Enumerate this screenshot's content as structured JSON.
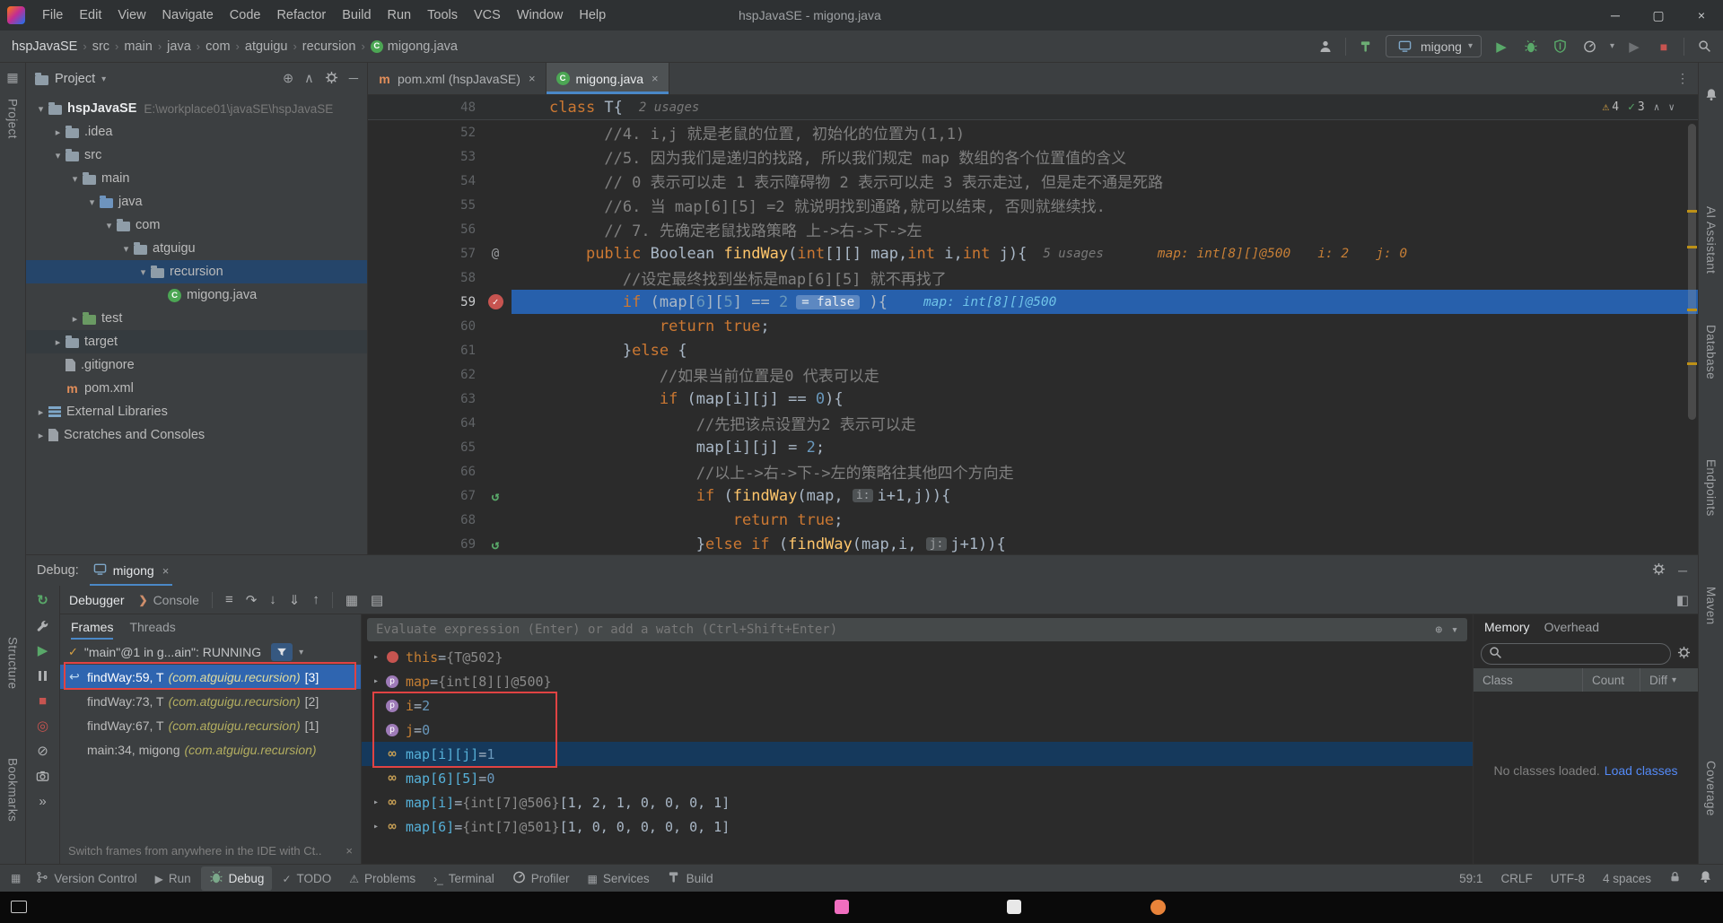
{
  "window": {
    "title": "hspJavaSE - migong.java"
  },
  "menubar": [
    "File",
    "Edit",
    "View",
    "Navigate",
    "Code",
    "Refactor",
    "Build",
    "Run",
    "Tools",
    "VCS",
    "Window",
    "Help"
  ],
  "breadcrumbs": [
    "hspJavaSE",
    "src",
    "main",
    "java",
    "com",
    "atguigu",
    "recursion",
    "migong.java"
  ],
  "run": {
    "config": "migong"
  },
  "left_strip": {
    "labels": [
      "Project",
      "Structure",
      "Bookmarks"
    ]
  },
  "right_strip": {
    "labels": [
      "AI Assistant",
      "Database",
      "Endpoints",
      "Maven",
      "Coverage"
    ]
  },
  "project": {
    "title": "Project",
    "tree": [
      {
        "label": "hspJavaSE",
        "suffix": "E:\\workplace01\\javaSE\\hspJavaSE",
        "level": 0,
        "icon": "folder",
        "chev": "open",
        "bold": true
      },
      {
        "label": ".idea",
        "level": 1,
        "icon": "folder",
        "chev": "closed"
      },
      {
        "label": "src",
        "level": 1,
        "icon": "folder",
        "chev": "open"
      },
      {
        "label": "main",
        "level": 2,
        "icon": "folder",
        "chev": "open"
      },
      {
        "label": "java",
        "level": 3,
        "icon": "folder-src",
        "chev": "open"
      },
      {
        "label": "com",
        "level": 4,
        "icon": "folder",
        "chev": "open"
      },
      {
        "label": "atguigu",
        "level": 5,
        "icon": "folder",
        "chev": "open"
      },
      {
        "label": "recursion",
        "level": 6,
        "icon": "folder",
        "chev": "open",
        "selected": true
      },
      {
        "label": "migong.java",
        "level": 7,
        "icon": "class"
      },
      {
        "label": "test",
        "level": 2,
        "icon": "folder-test",
        "chev": "closed"
      },
      {
        "label": "target",
        "level": 1,
        "icon": "folder",
        "chev": "closed",
        "hover": true
      },
      {
        "label": ".gitignore",
        "level": 1,
        "icon": "file"
      },
      {
        "label": "pom.xml",
        "level": 1,
        "icon": "maven"
      },
      {
        "label": "External Libraries",
        "level": 0,
        "icon": "lib",
        "chev": "closed"
      },
      {
        "label": "Scratches and Consoles",
        "level": 0,
        "icon": "scratch",
        "chev": "closed"
      }
    ]
  },
  "editor": {
    "tabs": [
      {
        "label": "pom.xml (hspJavaSE)",
        "icon": "maven"
      },
      {
        "label": "migong.java",
        "icon": "class",
        "active": true
      }
    ],
    "sticky": {
      "num": "48",
      "segments": [
        {
          "c": "k",
          "t": "class "
        },
        {
          "c": "p",
          "t": "T{"
        },
        {
          "c": "u",
          "t": "2 usages"
        }
      ]
    },
    "inspections": {
      "warnings": "4",
      "passed": "3"
    },
    "lines": [
      {
        "num": "52",
        "segments": [
          {
            "c": "cmt",
            "t": "      //4. i,j 就是老鼠的位置, 初始化的位置为(1,1)"
          }
        ]
      },
      {
        "num": "53",
        "segments": [
          {
            "c": "cmt",
            "t": "      //5. 因为我们是递归的找路, 所以我们规定 map 数组的各个位置值的含义"
          }
        ]
      },
      {
        "num": "54",
        "segments": [
          {
            "c": "cmt",
            "t": "      // 0 表示可以走 1 表示障碍物 2 表示可以走 3 表示走过, 但是走不通是死路"
          }
        ]
      },
      {
        "num": "55",
        "segments": [
          {
            "c": "cmt",
            "t": "      //6. 当 map[6][5] =2 就说明找到通路,就可以结束, 否则就继续找."
          }
        ]
      },
      {
        "num": "56",
        "segments": [
          {
            "c": "cmt",
            "t": "      // 7. 先确定老鼠找路策略 上->右->下->左"
          }
        ]
      },
      {
        "num": "57",
        "icon": "at",
        "segments": [
          {
            "c": "p",
            "t": "    "
          },
          {
            "c": "k",
            "t": "public "
          },
          {
            "c": "p",
            "t": "Boolean "
          },
          {
            "c": "m",
            "t": "findWay"
          },
          {
            "c": "p",
            "t": "("
          },
          {
            "c": "k",
            "t": "int"
          },
          {
            "c": "p",
            "t": "[][] map,"
          },
          {
            "c": "k",
            "t": "int"
          },
          {
            "c": "p",
            "t": " i,"
          },
          {
            "c": "k",
            "t": "int"
          },
          {
            "c": "p",
            "t": " j){"
          },
          {
            "c": "u",
            "t": "5 usages"
          },
          {
            "c": "hg gapxl",
            "t": "map: int[8][]@500"
          },
          {
            "c": "hg gap",
            "t": "i: 2"
          },
          {
            "c": "hg gap",
            "t": "j: 0"
          }
        ]
      },
      {
        "num": "58",
        "segments": [
          {
            "c": "cmt",
            "t": "        //设定最终找到坐标是map[6][5] 就不再找了"
          }
        ]
      },
      {
        "num": "59",
        "icon": "bp",
        "exec": true,
        "segments": [
          {
            "c": "p",
            "t": "        "
          },
          {
            "c": "k",
            "t": "if"
          },
          {
            "c": "p",
            "t": " (map["
          },
          {
            "c": "n",
            "t": "6"
          },
          {
            "c": "p",
            "t": "]["
          },
          {
            "c": "n",
            "t": "5"
          },
          {
            "c": "p",
            "t": "] == "
          },
          {
            "c": "n",
            "t": "2"
          },
          {
            "c": "chip",
            "t": "= false"
          },
          {
            "c": "p",
            "t": " ){"
          },
          {
            "c": "hc gapl",
            "t": "map: int[8][]@500"
          }
        ]
      },
      {
        "num": "60",
        "segments": [
          {
            "c": "p",
            "t": "            "
          },
          {
            "c": "k",
            "t": "return true"
          },
          {
            "c": "p",
            "t": ";"
          }
        ]
      },
      {
        "num": "61",
        "segments": [
          {
            "c": "p",
            "t": "        }"
          },
          {
            "c": "k",
            "t": "else"
          },
          {
            "c": "p",
            "t": " {"
          }
        ]
      },
      {
        "num": "62",
        "segments": [
          {
            "c": "cmt",
            "t": "            //如果当前位置是0 代表可以走"
          }
        ]
      },
      {
        "num": "63",
        "segments": [
          {
            "c": "p",
            "t": "            "
          },
          {
            "c": "k",
            "t": "if"
          },
          {
            "c": "p",
            "t": " (map[i][j] == "
          },
          {
            "c": "n",
            "t": "0"
          },
          {
            "c": "p",
            "t": "){"
          }
        ]
      },
      {
        "num": "64",
        "segments": [
          {
            "c": "cmt",
            "t": "                //先把该点设置为2 表示可以走"
          }
        ]
      },
      {
        "num": "65",
        "segments": [
          {
            "c": "p",
            "t": "                map[i][j] = "
          },
          {
            "c": "n",
            "t": "2"
          },
          {
            "c": "p",
            "t": ";"
          }
        ]
      },
      {
        "num": "66",
        "segments": [
          {
            "c": "cmt",
            "t": "                //以上->右->下->左的策略往其他四个方向走"
          }
        ]
      },
      {
        "num": "67",
        "icon": "recur",
        "segments": [
          {
            "c": "p",
            "t": "                "
          },
          {
            "c": "k",
            "t": "if"
          },
          {
            "c": "p",
            "t": " ("
          },
          {
            "c": "m",
            "t": "findWay"
          },
          {
            "c": "p",
            "t": "(map, "
          },
          {
            "c": "pchip",
            "t": "i:"
          },
          {
            "c": "p",
            "t": "i+1,j)){"
          }
        ]
      },
      {
        "num": "68",
        "segments": [
          {
            "c": "p",
            "t": "                    "
          },
          {
            "c": "k",
            "t": "return true"
          },
          {
            "c": "p",
            "t": ";"
          }
        ]
      },
      {
        "num": "69",
        "icon": "recur",
        "segments": [
          {
            "c": "p",
            "t": "                }"
          },
          {
            "c": "k",
            "t": "else if"
          },
          {
            "c": "p",
            "t": " ("
          },
          {
            "c": "m",
            "t": "findWay"
          },
          {
            "c": "p",
            "t": "(map,i, "
          },
          {
            "c": "pchip",
            "t": "j:"
          },
          {
            "c": "p",
            "t": "j+1)){"
          }
        ]
      }
    ]
  },
  "debug": {
    "label": "Debug:",
    "tab": "migong",
    "tabs": [
      "Debugger",
      "Console"
    ],
    "frames_tabs": [
      "Frames",
      "Threads"
    ],
    "thread": "\"main\"@1 in g...ain\": RUNNING",
    "frames": [
      {
        "text": "findWay:59, T ",
        "pkg": "(com.atguigu.recursion)",
        "tag": "[3]",
        "selected": true
      },
      {
        "text": "findWay:73, T ",
        "pkg": "(com.atguigu.recursion)",
        "tag": "[2]"
      },
      {
        "text": "findWay:67, T ",
        "pkg": "(com.atguigu.recursion)",
        "tag": "[1]"
      },
      {
        "text": "main:34, migong ",
        "pkg": "(com.atguigu.recursion)",
        "tag": ""
      }
    ],
    "frames_banner": "Switch frames from anywhere in the IDE with Ct..",
    "evaluate_placeholder": "Evaluate expression (Enter) or add a watch (Ctrl+Shift+Enter)",
    "variables": [
      {
        "expand": true,
        "icon": "this",
        "name": "this",
        "value": "{T@502}",
        "vc": "ref"
      },
      {
        "expand": true,
        "icon": "param",
        "name": "map",
        "value": "{int[8][]@500}",
        "vc": "ref"
      },
      {
        "icon": "param",
        "name": "i",
        "value": "2",
        "vc": "num"
      },
      {
        "icon": "param",
        "name": "j",
        "value": "0",
        "vc": "num"
      },
      {
        "icon": "watch",
        "wname": true,
        "name": "map[i][j]",
        "value": "1",
        "vc": "num",
        "selected": true
      },
      {
        "icon": "watch",
        "wname": true,
        "name": "map[6][5]",
        "value": "0",
        "vc": "num"
      },
      {
        "expand": true,
        "icon": "watch",
        "wname": true,
        "name": "map[i]",
        "value": "{int[7]@506}",
        "extra": " [1, 2, 1, 0, 0, 0, 1]",
        "vc": "ref"
      },
      {
        "expand": true,
        "icon": "watch",
        "wname": true,
        "name": "map[6]",
        "value": "{int[7]@501}",
        "extra": " [1, 0, 0, 0, 0, 0, 1]",
        "vc": "ref"
      }
    ]
  },
  "memory": {
    "tabs": [
      "Memory",
      "Overhead"
    ],
    "columns": [
      "Class",
      "Count",
      "Diff"
    ],
    "empty_text": "No classes loaded.",
    "load_link": "Load classes"
  },
  "statusbar": {
    "left": [
      {
        "icon": "branch",
        "label": "Version Control"
      },
      {
        "icon": "play",
        "label": "Run"
      },
      {
        "icon": "bug",
        "label": "Debug",
        "active": true
      },
      {
        "icon": "todo",
        "label": "TODO"
      },
      {
        "icon": "problems",
        "label": "Problems"
      },
      {
        "icon": "terminal",
        "label": "Terminal"
      },
      {
        "icon": "profiler",
        "label": "Profiler"
      },
      {
        "icon": "services",
        "label": "Services"
      },
      {
        "icon": "build",
        "label": "Build"
      }
    ],
    "right": [
      "59:1",
      "CRLF",
      "UTF-8",
      "4 spaces"
    ]
  },
  "colors": {
    "accent": "#4A88C7",
    "exec_line": "#2760AC",
    "error": "#C75450",
    "ok": "#59A869",
    "warning": "#D9A343"
  }
}
